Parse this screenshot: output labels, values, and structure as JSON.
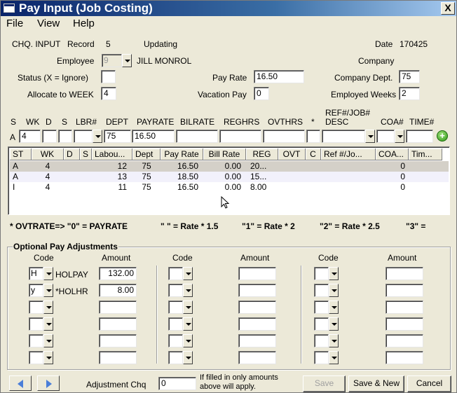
{
  "window": {
    "title": "Pay Input (Job Costing)",
    "close_glyph": "X"
  },
  "menu": [
    "File",
    "View",
    "Help"
  ],
  "info": {
    "chq_input": "CHQ. INPUT",
    "record_label": "Record",
    "record_value": "5",
    "status_text": "Updating",
    "date_label": "Date",
    "date_value": "170425",
    "employee_label": "Employee",
    "employee_code": "9",
    "employee_name": "JILL MONROL",
    "company_label": "Company",
    "status_label": "Status (X = Ignore)",
    "status_value": "",
    "pay_rate_label": "Pay Rate",
    "pay_rate_value": "16.50",
    "company_dept_label": "Company Dept.",
    "company_dept_value": "75",
    "allocate_label": "Allocate to WEEK",
    "allocate_value": "4",
    "vacation_pay_label": "Vacation Pay",
    "vacation_pay_value": "0",
    "employed_weeks_label": "Employed Weeks",
    "employed_weeks_value": "2"
  },
  "entry": {
    "headers": {
      "s": "S",
      "wk": "WK",
      "d": "D",
      "s2": "S",
      "lbr": "LBR#",
      "dept": "DEPT",
      "payrate": "PAYRATE",
      "bilrate": "BILRATE",
      "reghrs": "REGHRS",
      "ovthrs": "OVTHRS",
      "star": "*",
      "ref1": "REF#/JOB#",
      "ref2": "DESC",
      "coa": "COA#",
      "time": "TIME#"
    },
    "row_prefix": "A",
    "wk": "4",
    "d": "",
    "s": "",
    "lbr": "",
    "dept": "75",
    "payrate": "16.50",
    "bilrate": "",
    "reghrs": "",
    "ovthrs": "",
    "star": "",
    "ref": "",
    "coa": "",
    "time": ""
  },
  "grid": {
    "columns": [
      "ST",
      "WK",
      "D",
      "S",
      "Labou...",
      "Dept",
      "Pay Rate",
      "Bill Rate",
      "REG",
      "OVT",
      "C",
      "Ref #/Jo...",
      "COA...",
      "Tim..."
    ],
    "rows": [
      {
        "st": "A",
        "wk": "4",
        "d": "",
        "s": "",
        "labour": "12",
        "dept": "75",
        "pay_rate": "16.50",
        "bill_rate": "0.00",
        "reg": "20...",
        "ovt": "",
        "c": "",
        "ref": "",
        "coa": "0",
        "time": ""
      },
      {
        "st": "A",
        "wk": "4",
        "d": "",
        "s": "",
        "labour": "13",
        "dept": "75",
        "pay_rate": "18.50",
        "bill_rate": "0.00",
        "reg": "15...",
        "ovt": "",
        "c": "",
        "ref": "",
        "coa": "0",
        "time": ""
      },
      {
        "st": "I",
        "wk": "4",
        "d": "",
        "s": "",
        "labour": "11",
        "dept": "75",
        "pay_rate": "16.50",
        "bill_rate": "0.00",
        "reg": "8.00",
        "ovt": "",
        "c": "",
        "ref": "",
        "coa": "0",
        "time": ""
      }
    ],
    "selected_row_color": "#d4d0c8"
  },
  "notes": {
    "n0": "* OVTRATE=> \"0\" = PAYRATE",
    "n1": "\" \" = Rate * 1.5",
    "n2": "\"1\" = Rate * 2",
    "n3": "\"2\" = Rate * 2.5",
    "n4": "\"3\" ="
  },
  "adjustments": {
    "title": "Optional Pay Adjustments",
    "code_label": "Code",
    "amount_label": "Amount",
    "col1": [
      {
        "code": "H",
        "desc": "HOLPAY",
        "amount": "132.00"
      },
      {
        "code": "y",
        "desc": "*HOLHR",
        "amount": "8.00"
      },
      {
        "code": "",
        "desc": "",
        "amount": ""
      },
      {
        "code": "",
        "desc": "",
        "amount": ""
      },
      {
        "code": "",
        "desc": "",
        "amount": ""
      },
      {
        "code": "",
        "desc": "",
        "amount": ""
      }
    ]
  },
  "footer": {
    "adjustment_chq_label": "Adjustment Chq",
    "adjustment_chq_value": "0",
    "hint_line1": "If filled in only amounts",
    "hint_line2": "above will apply.",
    "save": "Save",
    "save_new": "Save & New",
    "cancel": "Cancel"
  },
  "colors": {
    "window_bg": "#ece9d8",
    "title_start": "#0a246a",
    "title_end": "#a6caf0",
    "nav_arrow": "#4a7ed8"
  }
}
